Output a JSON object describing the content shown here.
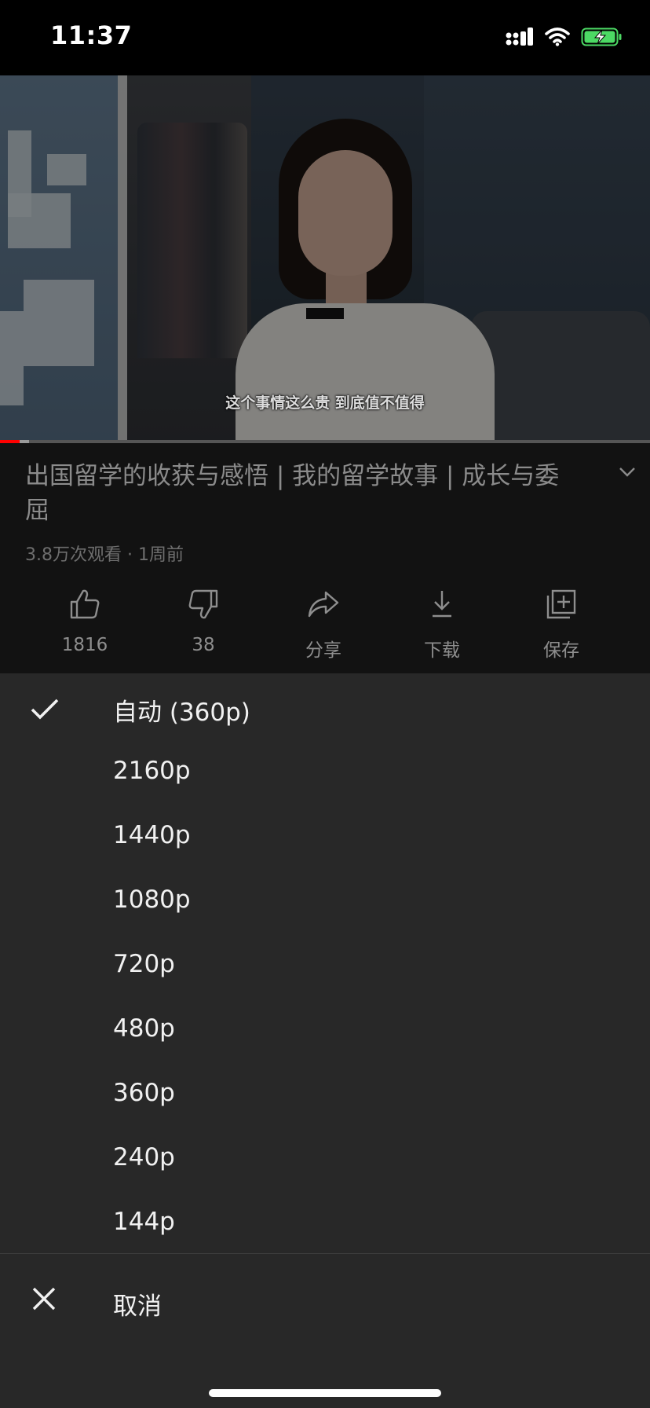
{
  "status_bar": {
    "time": "11:37",
    "icons": [
      "cellular-signal-icon",
      "wifi-icon",
      "battery-charging-icon"
    ],
    "battery_color": "#4cd964"
  },
  "video": {
    "subtitle": "这个事情这么贵 到底值不值得",
    "progress_played_fraction": 0.03,
    "progress_buffered_fraction": 0.045,
    "progress_color": "#ff0000"
  },
  "info": {
    "title": "出国留学的收获与感悟 | 我的留学故事 | 成长与委屈",
    "meta": "3.8万次观看 · 1周前",
    "actions": [
      {
        "icon": "thumb-up-icon",
        "label": "1816"
      },
      {
        "icon": "thumb-down-icon",
        "label": "38"
      },
      {
        "icon": "share-icon",
        "label": "分享"
      },
      {
        "icon": "download-icon",
        "label": "下载"
      },
      {
        "icon": "save-playlist-icon",
        "label": "保存"
      }
    ]
  },
  "quality_sheet": {
    "selected_index": 0,
    "options": [
      {
        "label": "自动 (360p)"
      },
      {
        "label": "2160p"
      },
      {
        "label": "1440p"
      },
      {
        "label": "1080p"
      },
      {
        "label": "720p"
      },
      {
        "label": "480p"
      },
      {
        "label": "360p"
      },
      {
        "label": "240p"
      },
      {
        "label": "144p"
      }
    ],
    "cancel_label": "取消"
  }
}
